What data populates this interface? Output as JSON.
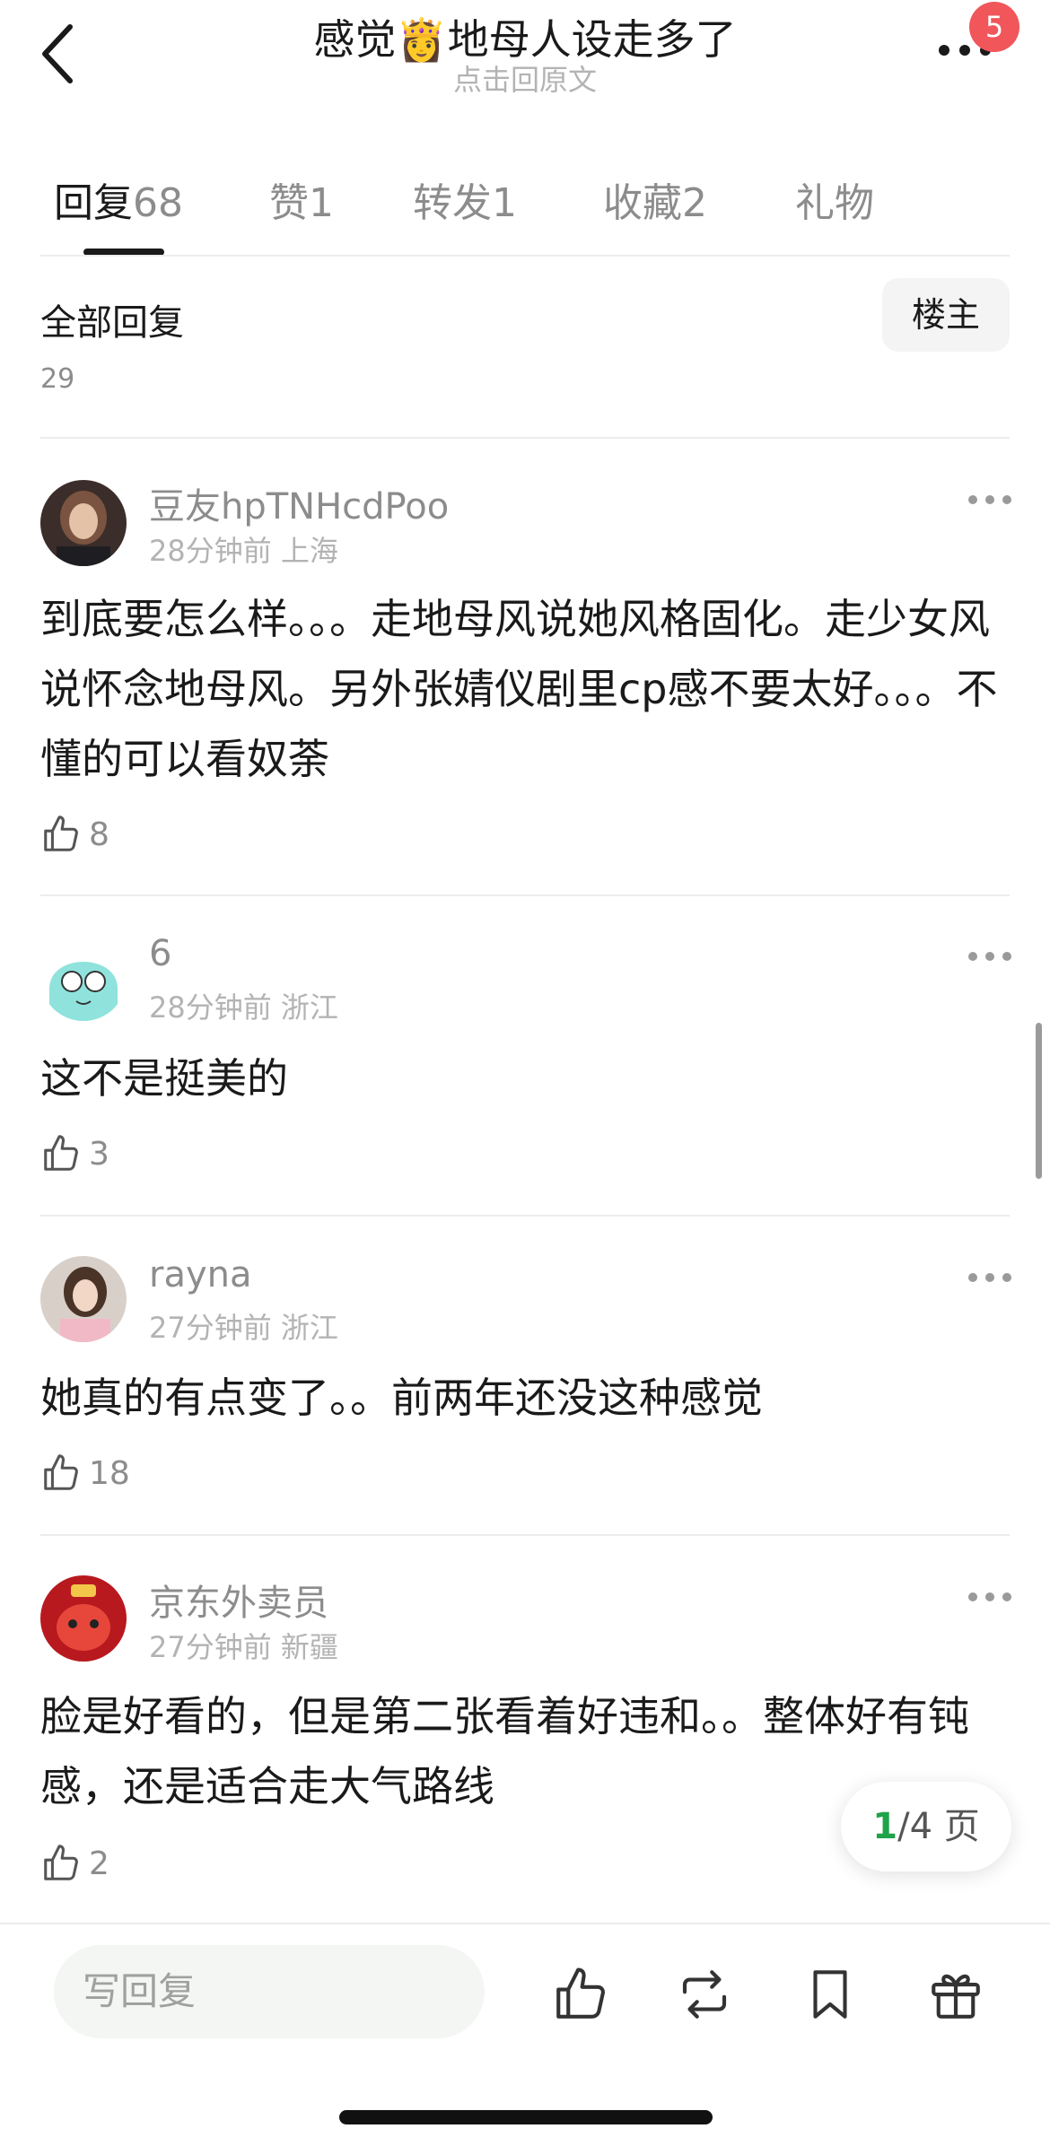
{
  "header": {
    "title": "感觉👸地母人设走多了",
    "subtitle": "点击回原文",
    "badge_count": "5"
  },
  "tabs": [
    {
      "label": "回复",
      "count": "68"
    },
    {
      "label": "赞",
      "count": "1"
    },
    {
      "label": "转发",
      "count": "1"
    },
    {
      "label": "收藏",
      "count": "2"
    },
    {
      "label": "礼物",
      "count": ""
    }
  ],
  "filter": {
    "label": "全部回复",
    "op_button": "楼主"
  },
  "partial_like_count": "29",
  "comments": [
    {
      "username": "豆友hpTNHcdPoo",
      "time": "28分钟前",
      "location": "上海",
      "content": "到底要怎么样。。。走地母风说她风格固化。走少女风说怀念地母风。另外张婧仪剧里cp感不要太好。。。不懂的可以看奴荼",
      "likes": "8"
    },
    {
      "username": "6",
      "time": "28分钟前",
      "location": "浙江",
      "content": "这不是挺美的",
      "likes": "3"
    },
    {
      "username": "rayna",
      "time": "27分钟前",
      "location": "浙江",
      "content": "她真的有点变了。。前两年还没这种感觉",
      "likes": "18"
    },
    {
      "username": "京东外卖员",
      "time": "27分钟前",
      "location": "新疆",
      "content": "脸是好看的，但是第二张看着好违和。。整体好有钝感，还是适合走大气路线",
      "likes": "2"
    }
  ],
  "pagination": {
    "current": "1",
    "total_text": "/4 页"
  },
  "bottom_bar": {
    "reply_placeholder": "写回复",
    "icons": [
      "like-icon",
      "repost-icon",
      "bookmark-icon",
      "gift-icon"
    ]
  },
  "colors": {
    "badge": "#f0565a",
    "page_current": "#1fa34a",
    "muted_text": "#8c8c8c"
  }
}
